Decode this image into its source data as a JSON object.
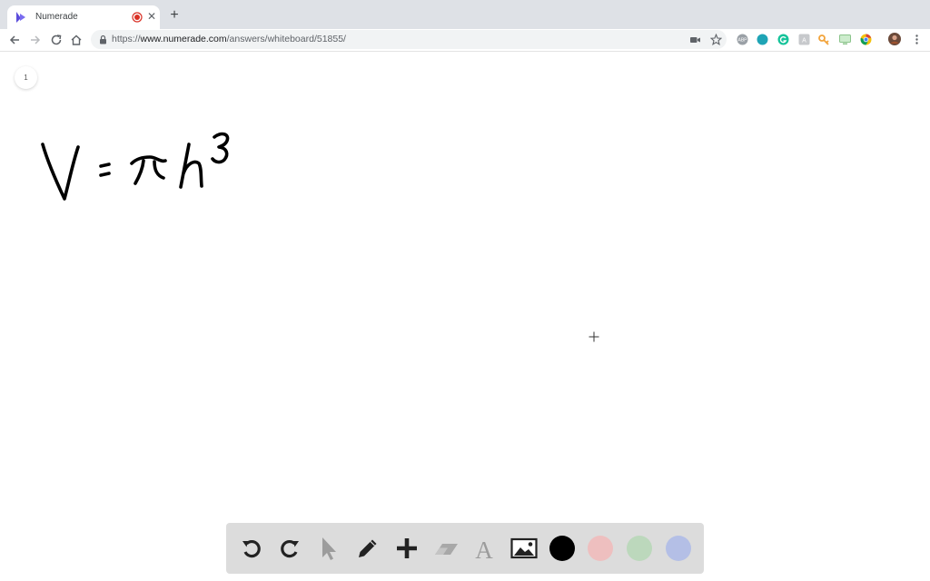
{
  "browser": {
    "tab": {
      "title": "Numerade",
      "close_glyph": "✕"
    },
    "new_tab_glyph": "+",
    "url": {
      "scheme": "https://",
      "host": "www.numerade.com",
      "path": "/answers/whiteboard/51855/"
    },
    "extensions": [
      "abp-icon",
      "teal-extension-icon",
      "grammarly-icon",
      "translate-icon",
      "key-icon",
      "screen-icon",
      "chrome-extension-icon",
      "profile-avatar"
    ]
  },
  "whiteboard": {
    "page_number": "1",
    "equation_text": "V = πh³"
  },
  "toolbar": {
    "tools": [
      "undo-icon",
      "redo-icon",
      "select-pointer-icon",
      "pen-icon",
      "add-shape-icon",
      "eraser-icon",
      "text-icon",
      "image-icon"
    ],
    "colors": {
      "black": "#000000",
      "red": "#eebfbf",
      "green": "#bcd8bc",
      "blue": "#b4bfe6"
    }
  }
}
